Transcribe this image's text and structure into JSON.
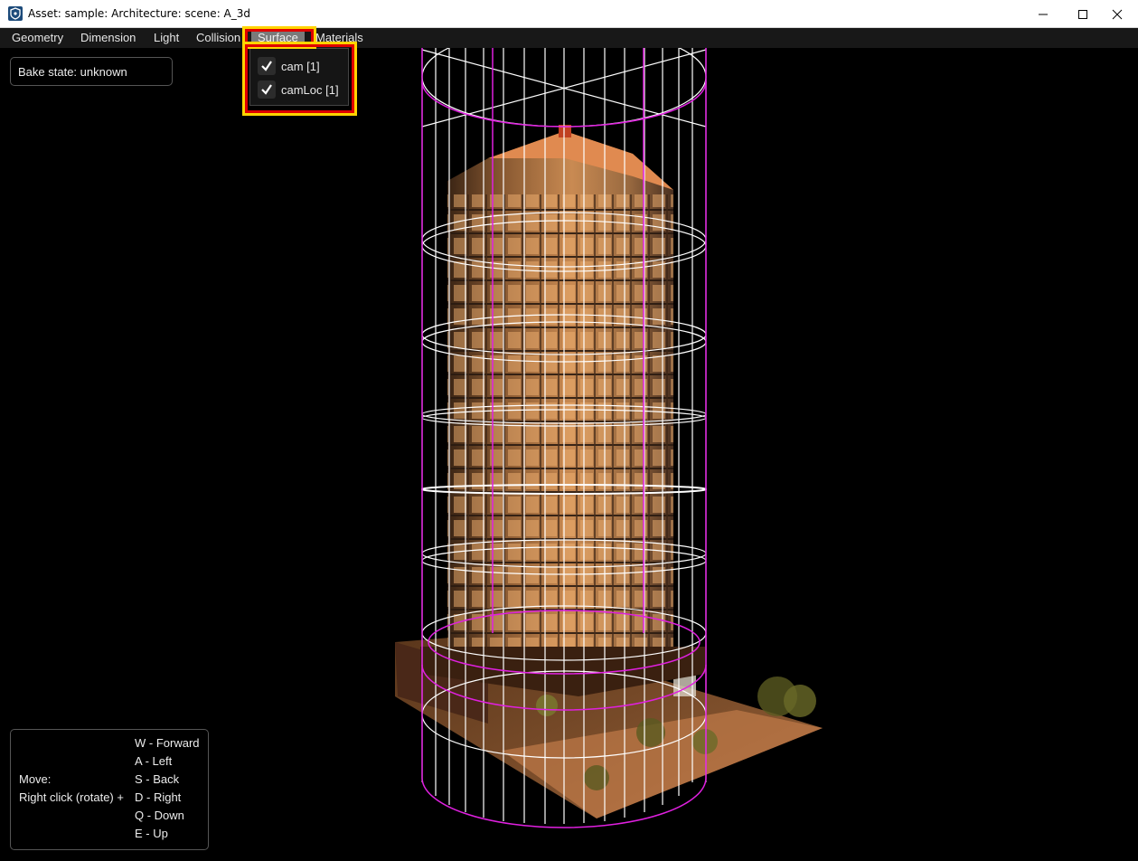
{
  "window": {
    "title": "Asset: sample: Architecture: scene: A_3d"
  },
  "menubar": {
    "items": [
      {
        "label": "Geometry"
      },
      {
        "label": "Dimension"
      },
      {
        "label": "Light"
      },
      {
        "label": "Collision"
      },
      {
        "label": "Surface",
        "active": true
      },
      {
        "label": "Materials"
      }
    ]
  },
  "surface_menu": {
    "items": [
      {
        "label": "cam [1]",
        "checked": true
      },
      {
        "label": "camLoc [1]",
        "checked": true
      }
    ]
  },
  "bake_state": {
    "label": "Bake state: unknown"
  },
  "controls_help": {
    "move_label": "Move:",
    "rotate_label": "Right click (rotate) +",
    "keys": [
      "W - Forward",
      "A - Left",
      "S - Back",
      "D - Right",
      "Q - Down",
      "E - Up"
    ]
  },
  "colors": {
    "highlight_outer": "#ffd400",
    "highlight_inner": "#e00000",
    "wireframe": "#ffffff",
    "bounds": "#e020e0"
  }
}
